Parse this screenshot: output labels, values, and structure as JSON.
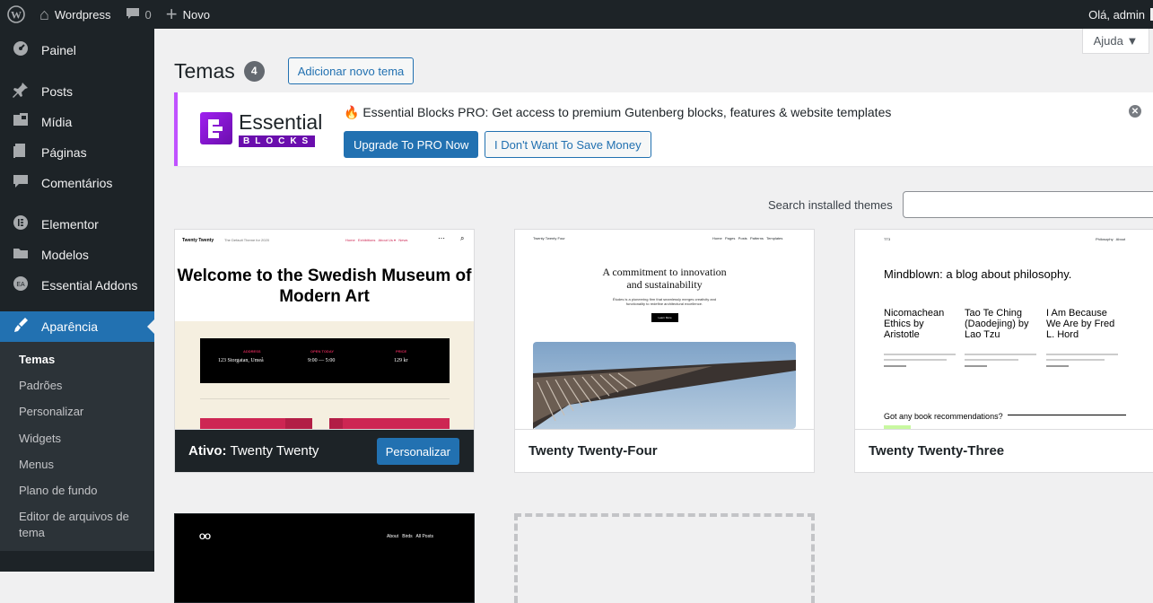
{
  "adminbar": {
    "site_name": "Wordpress",
    "comments_count": "0",
    "new_label": "Novo",
    "greeting": "Olá, admin"
  },
  "sidebar": {
    "items": [
      {
        "label": "Painel",
        "icon": "dashboard-icon"
      },
      {
        "label": "Posts",
        "icon": "pin-icon"
      },
      {
        "label": "Mídia",
        "icon": "media-icon"
      },
      {
        "label": "Páginas",
        "icon": "pages-icon"
      },
      {
        "label": "Comentários",
        "icon": "comments-icon"
      },
      {
        "label": "Elementor",
        "icon": "elementor-icon"
      },
      {
        "label": "Modelos",
        "icon": "folder-icon"
      },
      {
        "label": "Essential Addons",
        "icon": "essential-addons-icon"
      },
      {
        "label": "Aparência",
        "icon": "appearance-icon"
      }
    ],
    "submenu": [
      "Temas",
      "Padrões",
      "Personalizar",
      "Widgets",
      "Menus",
      "Plano de fundo",
      "Editor de arquivos de tema"
    ]
  },
  "help_tab": "Ajuda ▼",
  "page": {
    "title": "Temas",
    "count": "4",
    "add_new_label": "Adicionar novo tema"
  },
  "notice": {
    "logo_word": "Essential",
    "logo_sub": "BLOCKS",
    "text": "🔥 Essential Blocks PRO: Get access to premium Gutenberg blocks, features & website templates",
    "primary_button": "Upgrade To PRO Now",
    "secondary_button": "I Don't Want To Save Money"
  },
  "search": {
    "label": "Search installed themes",
    "value": ""
  },
  "themes": [
    {
      "active_prefix": "Ativo:",
      "name": "Twenty Twenty",
      "customize_label": "Personalizar",
      "preview": {
        "site_title": "Twenty Twenty",
        "tagline": "The Default Theme for 2020",
        "nav": "Home   Exhibitions   About Us ▾   News",
        "heading": "Welcome to the Swedish Museum of Modern Art",
        "address_label": "ADDRESS",
        "address": "123 Storgatan, Umeå",
        "open_label": "OPEN TODAY",
        "open": "9:00 — 5:00",
        "price_label": "PRICE",
        "price": "129 kr"
      }
    },
    {
      "name": "Twenty Twenty-Four",
      "preview": {
        "site_title": "Twenty Twenty Four",
        "nav": "Home   Pages   Posts   Patterns   Templates",
        "heading": "A commitment to innovation and sustainability",
        "body": "Études is a pioneering firm that seamlessly merges creativity and functionality to redefine architectural excellence.",
        "button": "Learn More"
      }
    },
    {
      "name": "Twenty Twenty-Three",
      "preview": {
        "site_title": "TT3",
        "nav": "Philosophy   About",
        "heading": "Mindblown: a blog about philosophy.",
        "posts": [
          "Nicomachean Ethics by Aristotle",
          "Tao Te Ching (Daodejing) by Lao Tzu",
          "I Am Because We Are by Fred L. Hord"
        ],
        "question": "Got any book recommendations?"
      }
    },
    {
      "preview": {
        "logo": "OO",
        "nav": "About   Birds   All Posts"
      }
    }
  ],
  "colors": {
    "admin_dark": "#1d2327",
    "accent": "#2271b1",
    "notice_border": "#c052ff"
  }
}
